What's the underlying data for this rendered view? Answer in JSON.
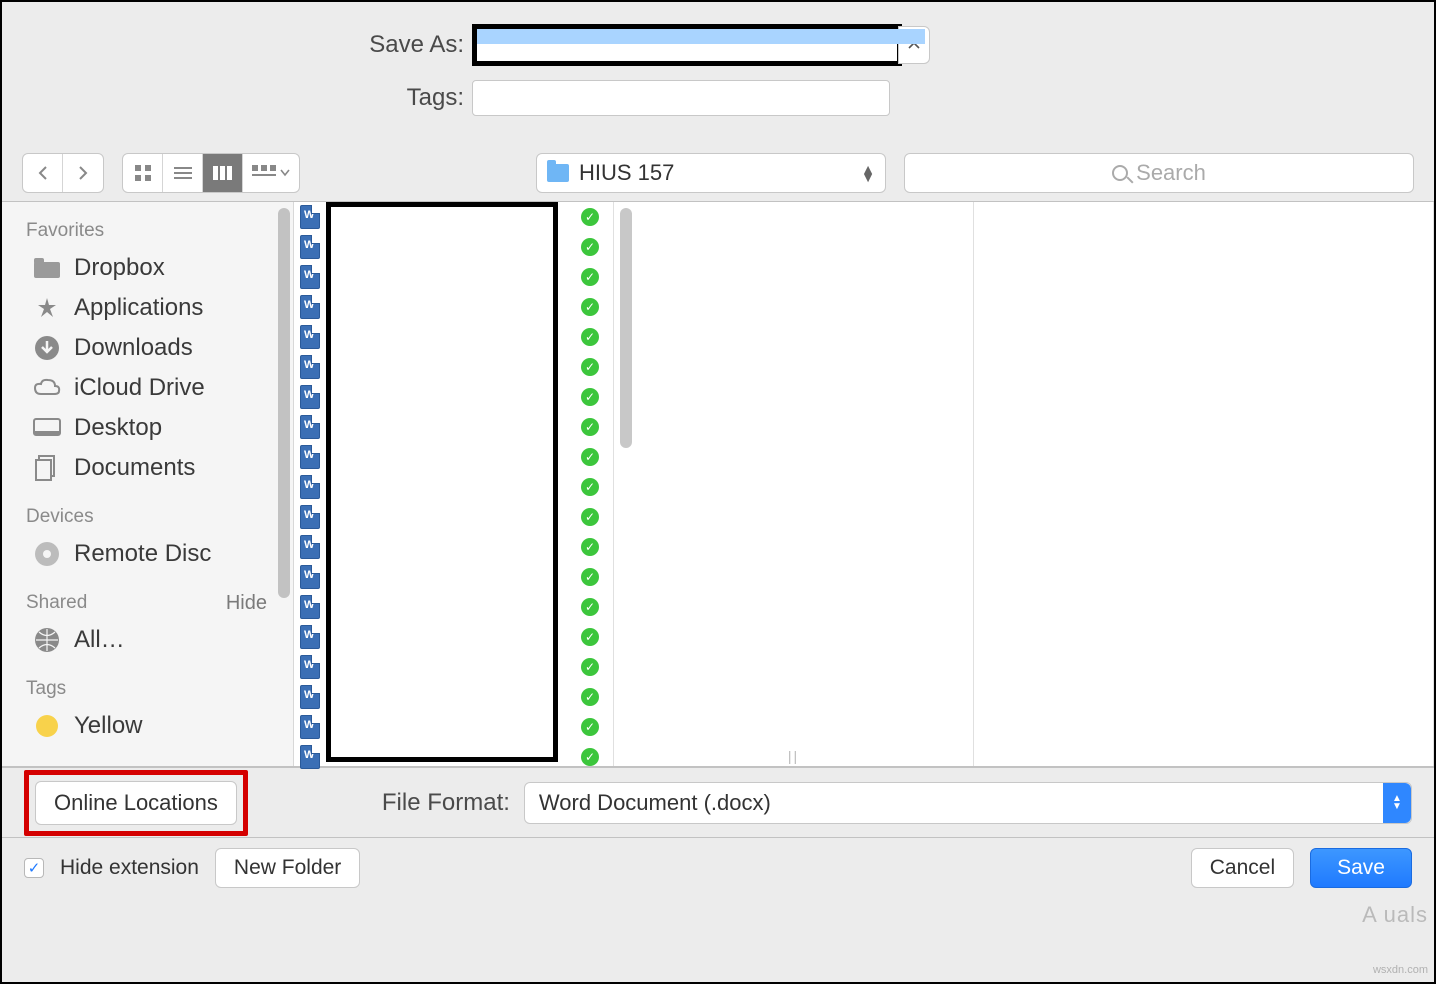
{
  "header": {
    "save_as_label": "Save As:",
    "save_as_value": "",
    "tags_label": "Tags:",
    "tags_value": ""
  },
  "toolbar": {
    "path_folder": "HIUS 157",
    "search_placeholder": "Search"
  },
  "sidebar": {
    "sections": {
      "favorites_title": "Favorites",
      "devices_title": "Devices",
      "shared_title": "Shared",
      "tags_title": "Tags",
      "hide_label": "Hide"
    },
    "favorites": [
      {
        "label": "Dropbox"
      },
      {
        "label": "Applications"
      },
      {
        "label": "Downloads"
      },
      {
        "label": "iCloud Drive"
      },
      {
        "label": "Desktop"
      },
      {
        "label": "Documents"
      }
    ],
    "devices": [
      {
        "label": "Remote Disc"
      }
    ],
    "shared": [
      {
        "label": "All…"
      }
    ],
    "tags": [
      {
        "label": "Yellow"
      }
    ]
  },
  "file_list": {
    "row_count": 19
  },
  "format": {
    "online_locations_label": "Online Locations",
    "file_format_label": "File Format:",
    "file_format_value": "Word Document (.docx)"
  },
  "footer": {
    "hide_extension_label": "Hide extension",
    "hide_extension_checked": true,
    "new_folder_label": "New Folder",
    "cancel_label": "Cancel",
    "save_label": "Save"
  },
  "watermark": {
    "brand": "A   uals",
    "credit": "wsxdn.com"
  }
}
